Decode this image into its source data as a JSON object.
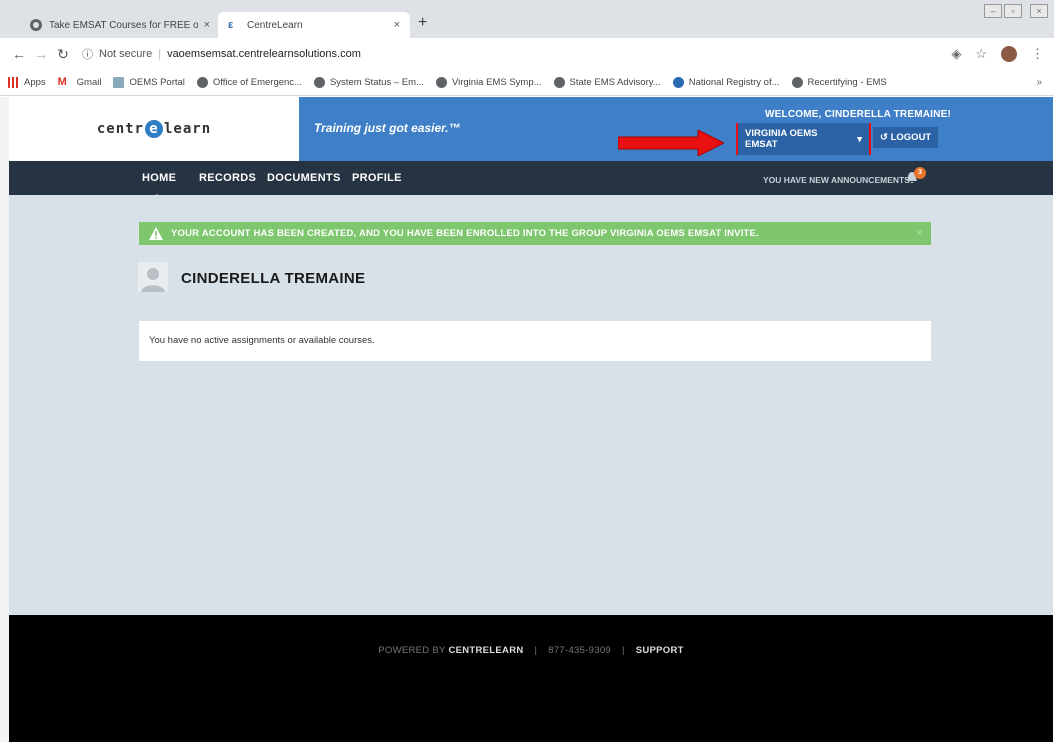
{
  "browser": {
    "tabs": [
      {
        "title": "Take EMSAT Courses for FREE or",
        "active": false
      },
      {
        "title": "CentreLearn",
        "active": true
      }
    ],
    "new_tab": "+",
    "close_glyph": "×",
    "address": {
      "security": "Not secure",
      "url": "vaoemsemsat.centrelearnsolutions.com"
    },
    "bookmarks": [
      {
        "label": "Apps",
        "icon": "apps-icon"
      },
      {
        "label": "Gmail",
        "icon": "gmail-icon"
      },
      {
        "label": "OEMS Portal",
        "icon": "portal-icon"
      },
      {
        "label": "Office of Emergenc...",
        "icon": "globe-icon"
      },
      {
        "label": "System Status – Em...",
        "icon": "globe-icon"
      },
      {
        "label": "Virginia EMS Symp...",
        "icon": "globe-icon"
      },
      {
        "label": "State EMS Advisory...",
        "icon": "globe-icon"
      },
      {
        "label": "National Registry of...",
        "icon": "registry-icon"
      },
      {
        "label": "Recertifying - EMS",
        "icon": "globe-icon"
      }
    ],
    "bookmarks_more": "»"
  },
  "header": {
    "logo_pre": "centr",
    "logo_e": "e",
    "logo_post": "learn",
    "tagline": "Training just got easier.™",
    "welcome": "WELCOME, CINDERELLA TREMAINE!",
    "group_label": "VIRGINIA OEMS EMSAT",
    "group_caret": "▾",
    "logout_label": "↺ LOGOUT"
  },
  "nav": {
    "items": [
      "HOME",
      "RECORDS",
      "DOCUMENTS",
      "PROFILE"
    ],
    "announcements": "YOU HAVE NEW ANNOUNCEMENTS",
    "announcement_count": "3"
  },
  "content": {
    "alert": "YOUR ACCOUNT HAS BEEN CREATED, AND YOU HAVE BEEN ENROLLED INTO THE GROUP VIRGINIA OEMS EMSAT INVITE.",
    "alert_close": "×",
    "user_name": "CINDERELLA TREMAINE",
    "courses_message": "You have no active assignments or available courses."
  },
  "footer": {
    "powered_by": "POWERED BY",
    "brand": "CENTRELEARN",
    "phone": "877-435-9309",
    "support": "SUPPORT"
  },
  "colors": {
    "header_blue": "#3f7fc7",
    "nav_dark": "#253342",
    "alert_green": "#7ec76f",
    "highlight_red": "#e81010",
    "content_bg": "#d9e1e8"
  }
}
